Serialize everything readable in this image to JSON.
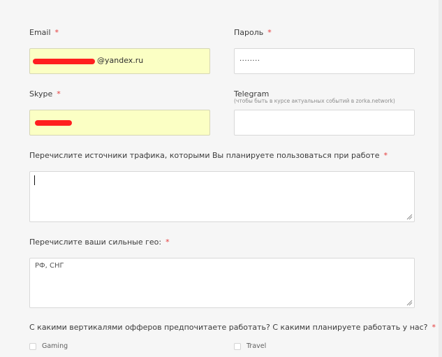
{
  "fields": {
    "email": {
      "label": "Email",
      "required": "*",
      "value": "@yandex.ru",
      "value_hidden": "redacted"
    },
    "password": {
      "label": "Пароль",
      "required": "*",
      "value": "........"
    },
    "skype": {
      "label": "Skype",
      "required": "*",
      "value_hidden": "redacted"
    },
    "telegram": {
      "label": "Telegram",
      "hint": "(чтобы быть в курсе актуальных событий в zorka.network)",
      "value": ""
    },
    "traffic_sources": {
      "label": "Перечислите источники трафика, которыми Вы планируете пользоваться при работе",
      "required": "*",
      "value": ""
    },
    "geo": {
      "label": "Перечислите ваши сильные гео:",
      "required": "*",
      "value": "РФ, СНГ"
    },
    "verticals": {
      "label": "С какими вертикалями офферов предпочитаете работать? С какими планируете работать у нас?",
      "required": "*",
      "options": [
        {
          "label": "Gaming",
          "checked": false
        },
        {
          "label": "Travel",
          "checked": false
        }
      ]
    }
  },
  "colors": {
    "required": "#e53b3b",
    "filled_field": "#fbffc4",
    "redaction": "#ff1f1f"
  }
}
